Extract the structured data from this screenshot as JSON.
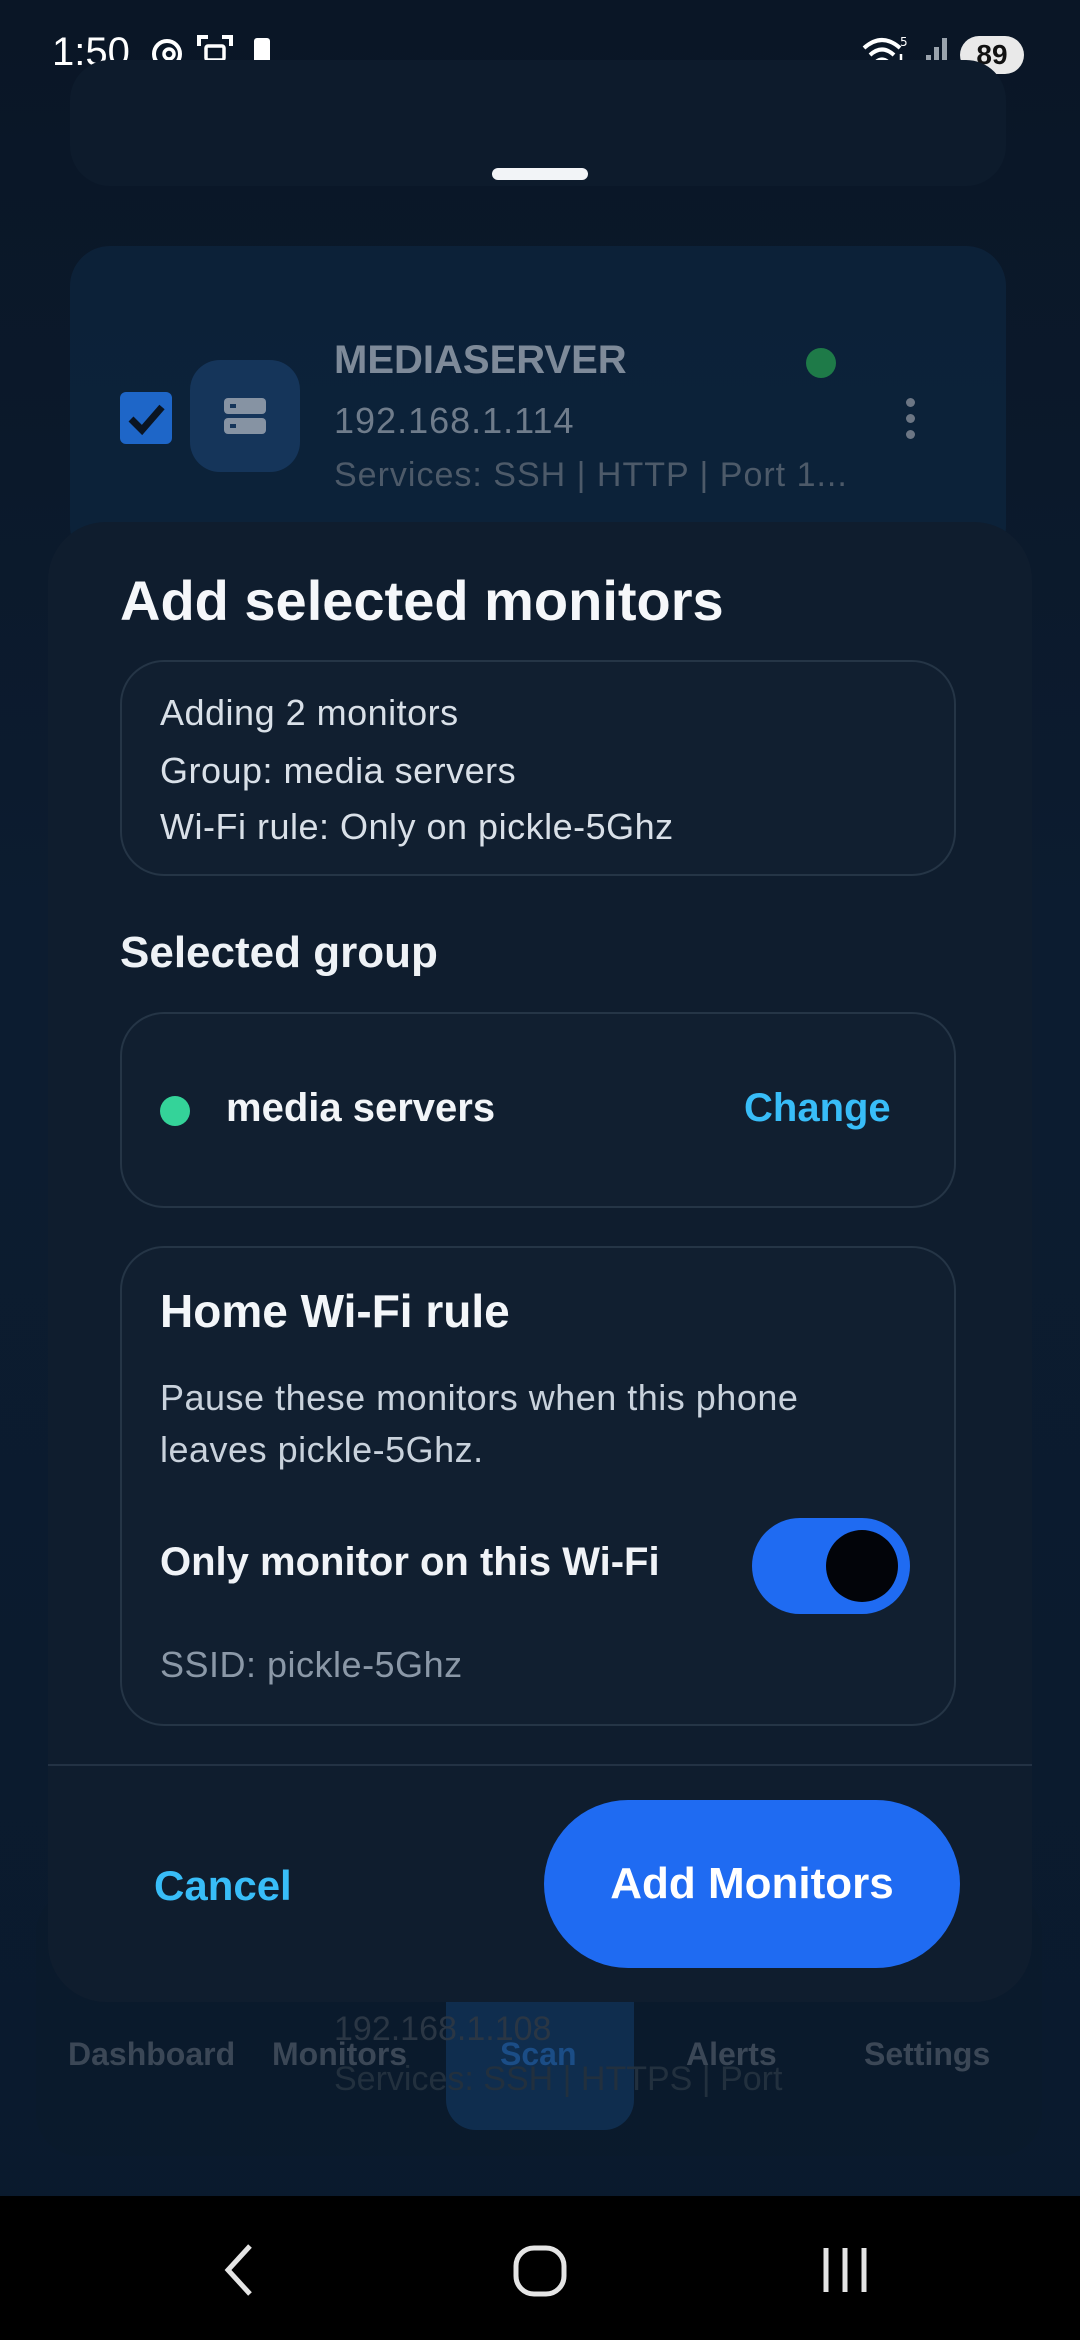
{
  "status_bar": {
    "time": "1:50",
    "battery": "89"
  },
  "background": {
    "server_name": "MEDIASERVER",
    "server_ip": "192.168.1.114",
    "server_services": "Services: SSH | HTTP | Port 1...",
    "ghost_ip": "192.168.1.108",
    "ghost_services": "Services: SSH | HTTPS | Port"
  },
  "bottom_nav": {
    "items": [
      {
        "label": "Dashboard"
      },
      {
        "label": "Monitors"
      },
      {
        "label": "Scan"
      },
      {
        "label": "Alerts"
      },
      {
        "label": "Settings"
      }
    ]
  },
  "sheet": {
    "title": "Add selected monitors",
    "summary": {
      "count_line": "Adding 2 monitors",
      "group_line": "Group: media servers",
      "wifi_line": "Wi-Fi rule: Only on pickle-5Ghz"
    },
    "selected_group_title": "Selected group",
    "group": {
      "name": "media servers",
      "change_label": "Change",
      "color": "#34d399"
    },
    "wifi_rule": {
      "title": "Home Wi-Fi rule",
      "description": "Pause these monitors when this phone leaves pickle-5Ghz.",
      "toggle_label": "Only monitor on this Wi-Fi",
      "toggle_on": true,
      "ssid": "SSID: pickle-5Ghz"
    },
    "cancel_label": "Cancel",
    "confirm_label": "Add Monitors"
  },
  "colors": {
    "accent": "#1f6bf2",
    "link": "#38bdf8",
    "online": "#34d399"
  }
}
